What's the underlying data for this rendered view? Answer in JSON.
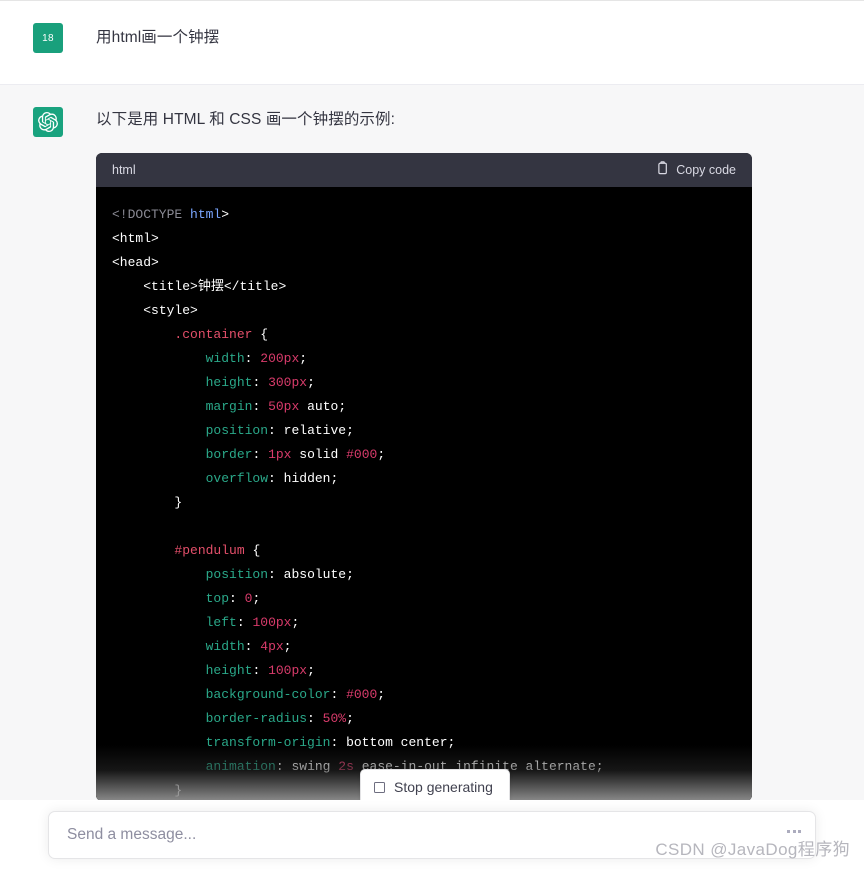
{
  "conversation": {
    "user_message": {
      "avatar_label": "18",
      "avatar_color": "#19a07c",
      "text": "用html画一个钟摆"
    },
    "assistant_message": {
      "avatar_icon": "openai-logo-icon",
      "avatar_color": "#19a37f",
      "text": "以下是用 HTML 和 CSS 画一个钟摆的示例:"
    }
  },
  "code_block": {
    "language_label": "html",
    "copy_label": "Copy code",
    "copy_icon": "clipboard-icon",
    "header_bg": "#343541",
    "body_bg": "#000000",
    "lines": [
      "<!DOCTYPE html>",
      "<html>",
      "<head>",
      "    <title>钟摆</title>",
      "    <style>",
      "        .container {",
      "            width: 200px;",
      "            height: 300px;",
      "            margin: 50px auto;",
      "            position: relative;",
      "            border: 1px solid #000;",
      "            overflow: hidden;",
      "        }",
      "",
      "        #pendulum {",
      "            position: absolute;",
      "            top: 0;",
      "            left: 100px;",
      "            width: 4px;",
      "            height: 100px;",
      "            background-color: #000;",
      "            border-radius: 50%;",
      "            transform-origin: bottom center;",
      "            animation: swing 2s ease-in-out infinite alternate;",
      "        }"
    ],
    "colors": {
      "selector": "#e34f6a",
      "property": "#2aa889",
      "number": "#d93b6b",
      "tag": "#ffffff",
      "doctype": "#8a8a94",
      "attribute_value": "#7aa6ff"
    }
  },
  "stop_generating": {
    "label": "Stop generating",
    "icon": "stop-square-icon"
  },
  "composer": {
    "placeholder": "Send a message...",
    "value": "",
    "menu_icon": "more-dots-icon"
  },
  "watermark": {
    "text": "CSDN @JavaDog程序狗"
  }
}
